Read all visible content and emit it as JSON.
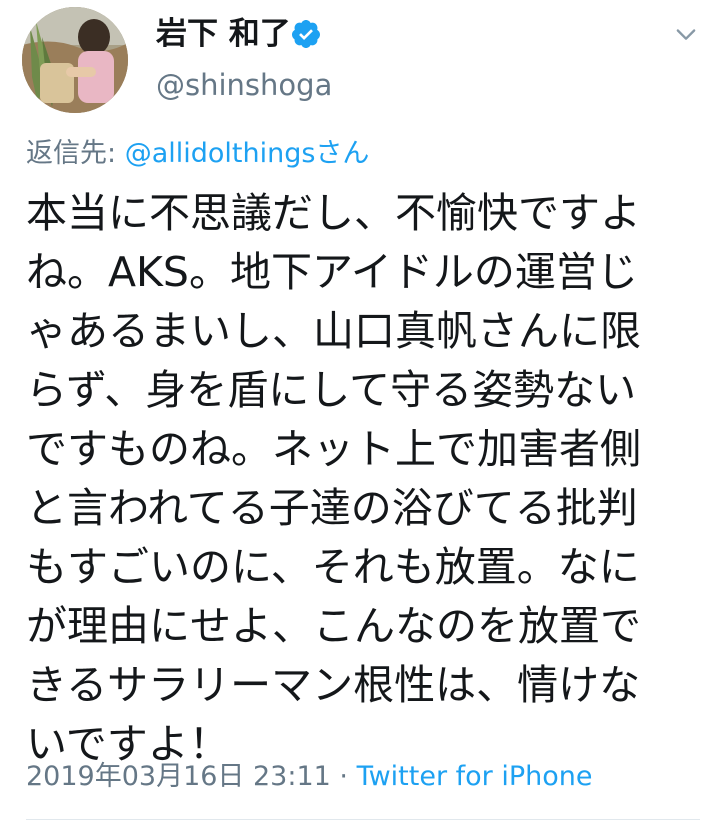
{
  "tweet": {
    "display_name": "岩下 和了",
    "handle": "@shinshoga",
    "reply_prefix": "返信先: ",
    "reply_mention": "@allidolthingsさん",
    "body_lines": [
      "本当に不思議だし、不愉快ですよ",
      "ね。AKS。地下アイドルの運営じ",
      "ゃあるまいし、山口真帆さんに限",
      "らず、身を盾にして守る姿勢ない",
      "ですものね。ネット上で加害者側",
      "と言われてる子達の浴びてる批判",
      "もすごいのに、それも放置。なに",
      "が理由にせよ、こんなのを放置で",
      "きるサラリーマン根性は、情けな",
      "いですよ！"
    ],
    "timestamp": "2019年03月16日 23:11",
    "separator": " · ",
    "source": "Twitter for iPhone"
  },
  "icons": {
    "verified": "verified-badge-icon",
    "menu": "chevron-down-icon"
  },
  "colors": {
    "text": "#14171a",
    "secondary": "#657786",
    "link": "#1da1f2",
    "divider": "#e1e8ed"
  }
}
